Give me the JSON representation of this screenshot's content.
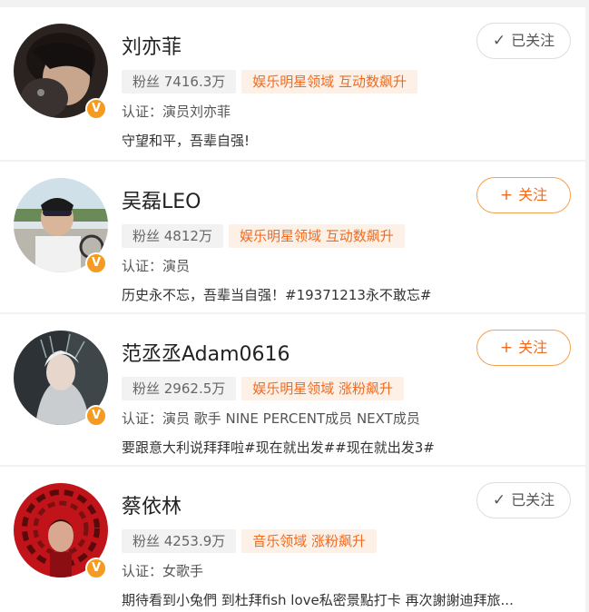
{
  "users": [
    {
      "name": "刘亦菲",
      "fans": "粉丝 7416.3万",
      "hot": "娱乐明星领域 互动数飙升",
      "cert": "认证：演员刘亦菲",
      "desc": "守望和平，吾辈自强!",
      "button_label": "已关注",
      "button_icon": "✓",
      "button_state": "followed"
    },
    {
      "name": "吴磊LEO",
      "fans": "粉丝 4812万",
      "hot": "娱乐明星领域 互动数飙升",
      "cert": "认证：演员",
      "desc": "历史永不忘，吾辈当自强！#19371213永不敢忘#",
      "button_label": "关注",
      "button_icon": "+",
      "button_state": "follow"
    },
    {
      "name": "范丞丞Adam0616",
      "fans": "粉丝 2962.5万",
      "hot": "娱乐明星领域 涨粉飙升",
      "cert": "认证：演员 歌手 NINE PERCENT成员 NEXT成员",
      "desc": "要跟意大利说拜拜啦#现在就出发##现在就出发3#",
      "button_label": "关注",
      "button_icon": "+",
      "button_state": "follow"
    },
    {
      "name": "蔡依林",
      "fans": "粉丝 4253.9万",
      "hot": "音乐领域 涨粉飙升",
      "cert": "认证：女歌手",
      "desc": "期待看到小兔們 到杜拜fish love私密景點打卡 再次謝謝迪拜旅...",
      "button_label": "已关注",
      "button_icon": "✓",
      "button_state": "followed"
    }
  ],
  "verified_badge": "V",
  "colors": {
    "accent": "#f36a1d",
    "badge": "#f59b22",
    "hot_bg": "#fdf0e6"
  }
}
